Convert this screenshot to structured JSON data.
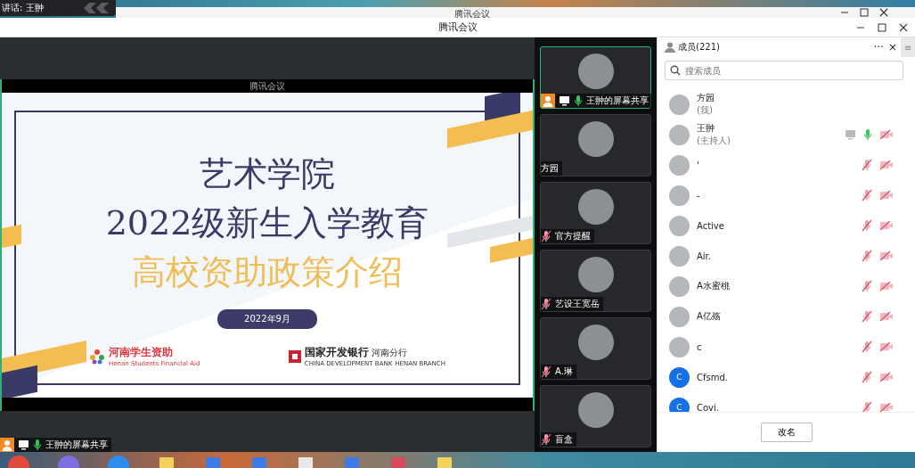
{
  "speaker_tooltip": {
    "text": "讲话: 王翀"
  },
  "back_window": {
    "title": "腾讯会议"
  },
  "window": {
    "title": "腾讯会议"
  },
  "shared_screen": {
    "app_label": "腾讯会议",
    "slide": {
      "lines": [
        {
          "text": "艺术学院",
          "kind": "title"
        },
        {
          "text": "2022级新生入学教育",
          "kind": "title"
        },
        {
          "text": "高校资助政策介绍",
          "kind": "accent"
        }
      ],
      "date": "2022年9月",
      "logo_left": {
        "name": "河南学生资助",
        "subtitle": "Henan Students Financial Aid"
      },
      "logo_right": {
        "name": "国家开发银行",
        "branch": "河南分行",
        "subtitle": "CHINA DEVELOPMENT BANK",
        "sub_branch": "HENAN BRANCH"
      }
    },
    "share_label": {
      "text": "王翀的屏幕共享",
      "host": true,
      "screen": true,
      "muted": false
    }
  },
  "thumbnails": [
    {
      "name": "王翀的屏幕共享",
      "selected": true,
      "host": true,
      "screen": true,
      "muted": false
    },
    {
      "name": "方园",
      "selected": false
    },
    {
      "name": "官方提醒",
      "selected": false,
      "muted": true
    },
    {
      "name": "艺设王宽岳",
      "selected": false,
      "muted": true
    },
    {
      "name": "A.琳",
      "selected": false,
      "muted": true
    },
    {
      "name": "盲盒",
      "selected": false,
      "muted": true
    }
  ],
  "members_panel": {
    "title": "成员(221)",
    "more": "···",
    "close": "×",
    "menu": "≡",
    "search": {
      "placeholder": "搜索成员"
    },
    "members": [
      {
        "name": "方园",
        "role": "(我)",
        "kind": "photo"
      },
      {
        "name": "王翀",
        "role": "(主持人)",
        "kind": "photo",
        "screen": true,
        "muted": false,
        "camera_off": true
      },
      {
        "name": "'",
        "kind": "photo",
        "muted": true,
        "camera_off": true
      },
      {
        "name": "-",
        "kind": "photo",
        "muted": true,
        "camera_off": true
      },
      {
        "name": "Active",
        "kind": "photo",
        "muted": true,
        "camera_off": true
      },
      {
        "name": "Air.",
        "kind": "photo",
        "muted": true,
        "camera_off": true
      },
      {
        "name": "A水蜜桃",
        "kind": "photo",
        "muted": true,
        "camera_off": true
      },
      {
        "name": "A亿殇",
        "kind": "photo",
        "muted": true,
        "camera_off": true
      },
      {
        "name": "c",
        "kind": "photo",
        "muted": true,
        "camera_off": true
      },
      {
        "name": "Cfsmd.",
        "kind": "letter",
        "letter": "C",
        "muted": true,
        "camera_off": true
      },
      {
        "name": "Covi.",
        "kind": "letter",
        "letter": "C",
        "muted": true,
        "camera_off": true
      }
    ],
    "rename_button": "改名"
  }
}
